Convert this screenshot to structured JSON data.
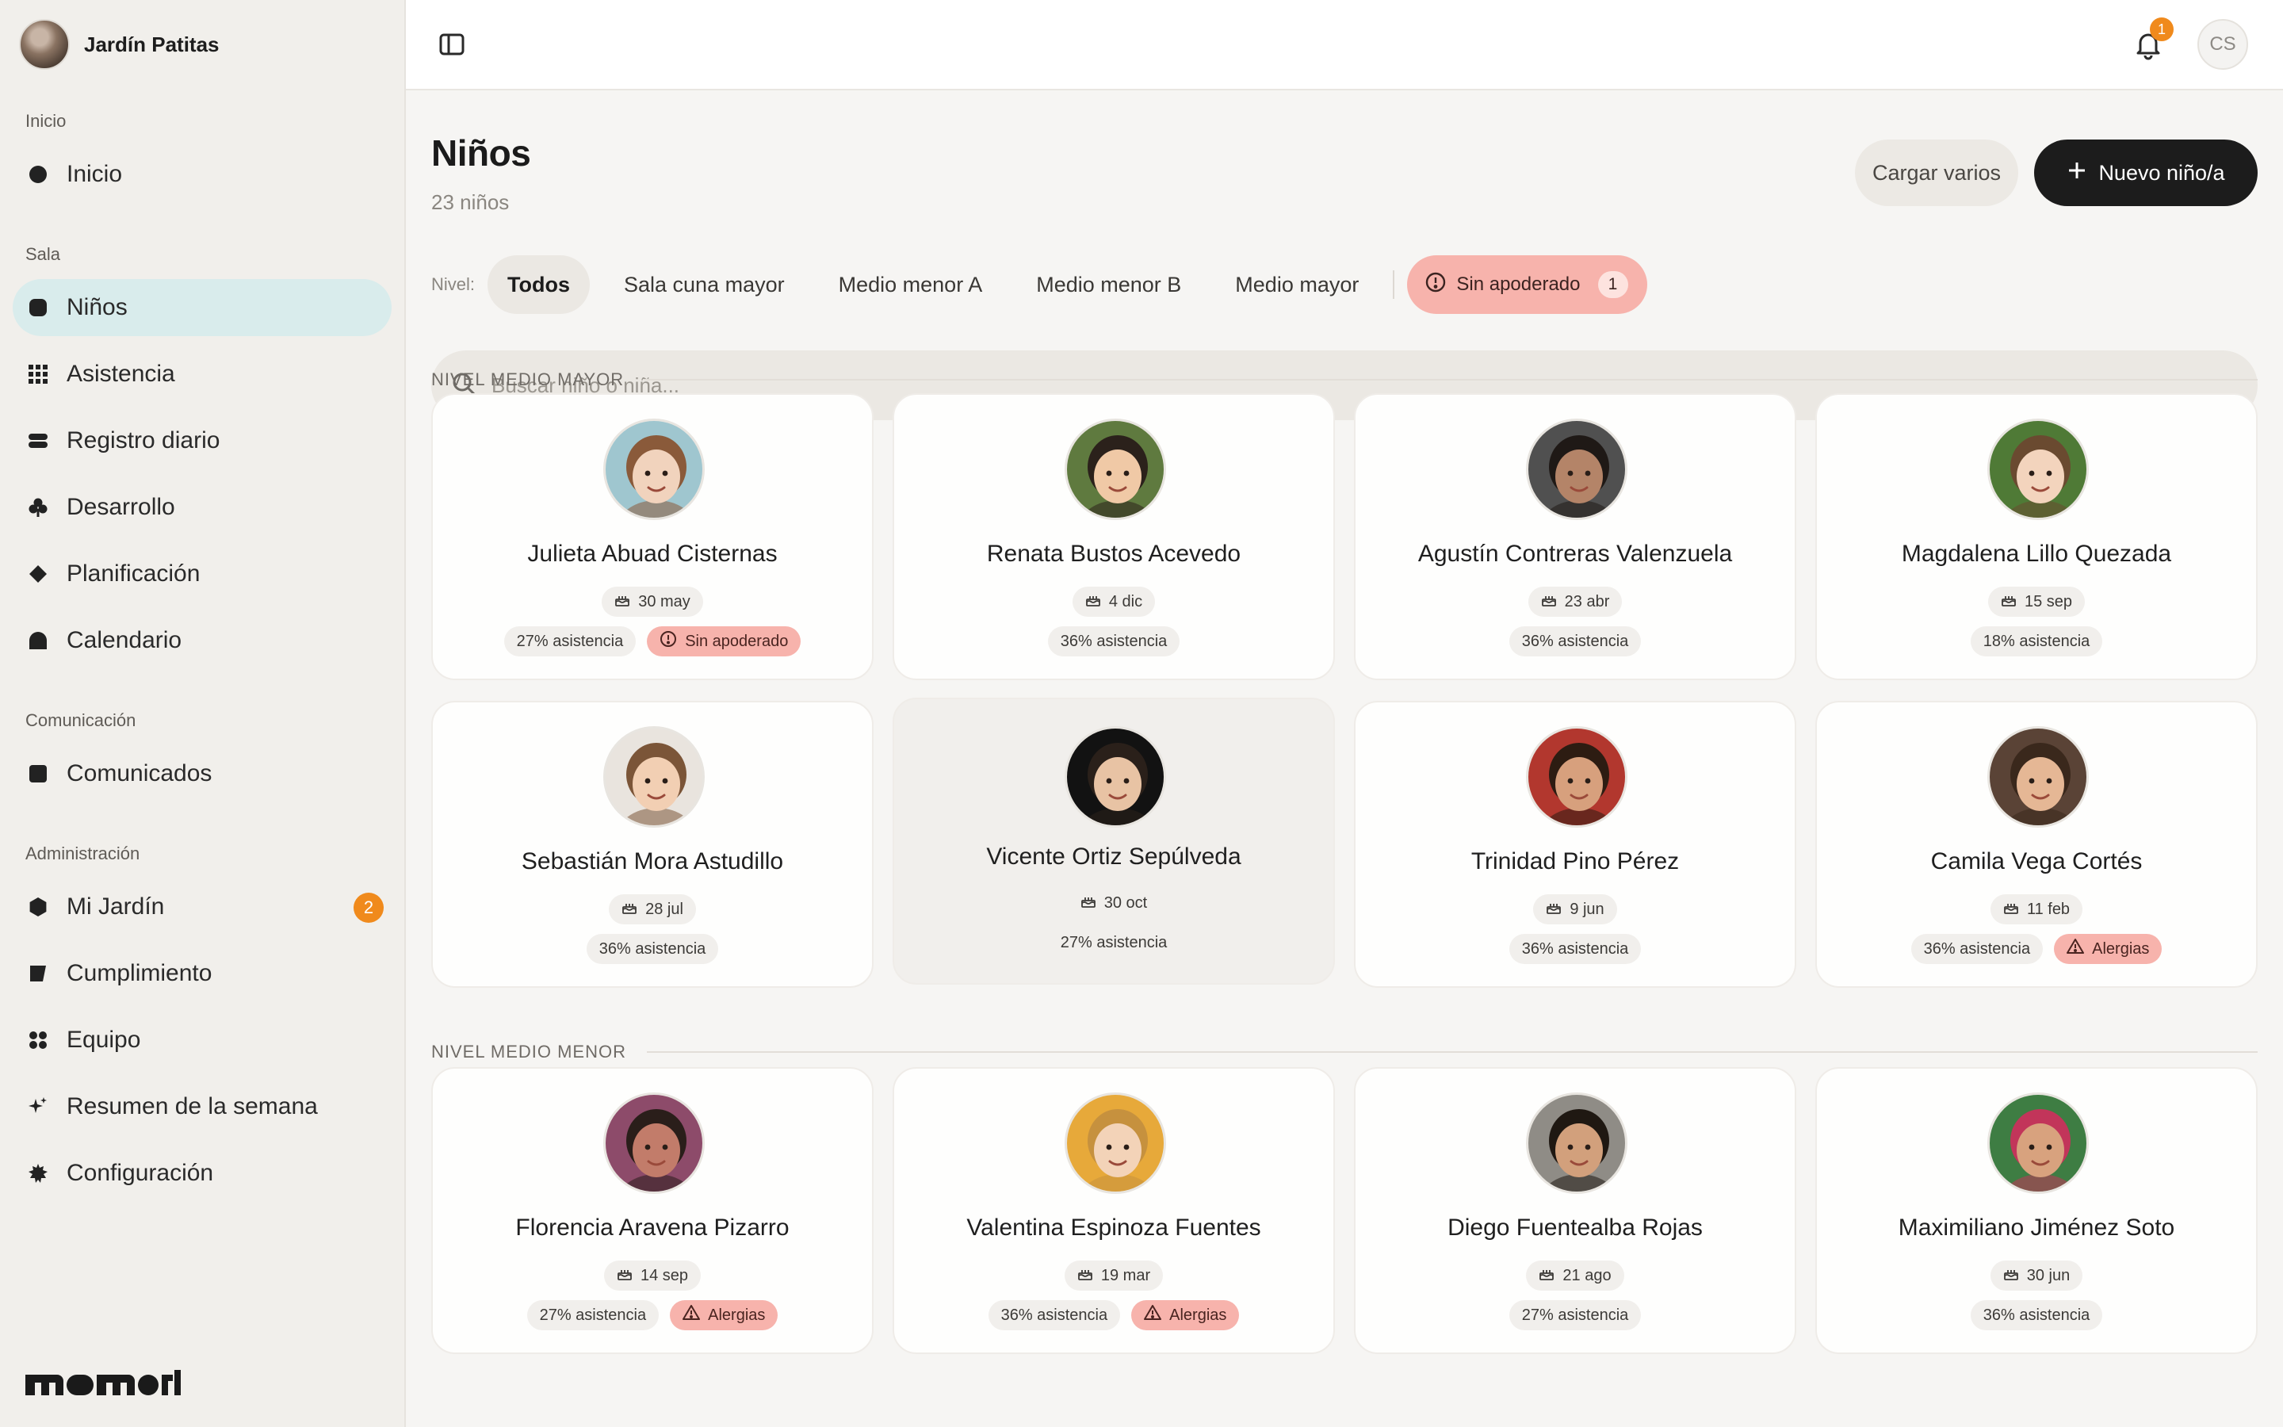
{
  "sidebar": {
    "brand_name": "Jardín Patitas",
    "sections": {
      "inicio": "Inicio",
      "sala": "Sala",
      "comunicacion": "Comunicación",
      "administracion": "Administración"
    },
    "items": [
      {
        "label": "Inicio",
        "icon": "circle-icon"
      },
      {
        "label": "Niños",
        "icon": "rounded-square-icon",
        "active": true
      },
      {
        "label": "Asistencia",
        "icon": "grid-icon"
      },
      {
        "label": "Registro diario",
        "icon": "stack-icon"
      },
      {
        "label": "Desarrollo",
        "icon": "club-icon"
      },
      {
        "label": "Planificación",
        "icon": "diamond-icon"
      },
      {
        "label": "Calendario",
        "icon": "dome-icon"
      },
      {
        "label": "Comunicados",
        "icon": "square-icon"
      },
      {
        "label": "Mi Jardín",
        "icon": "hexagon-icon",
        "badge": "2"
      },
      {
        "label": "Cumplimiento",
        "icon": "flag-icon"
      },
      {
        "label": "Equipo",
        "icon": "dots-icon"
      },
      {
        "label": "Resumen de la semana",
        "icon": "sparkle-icon"
      },
      {
        "label": "Configuración",
        "icon": "gear-icon"
      }
    ],
    "logo_text": "momori"
  },
  "topbar": {
    "notification_count": "1",
    "user_initials": "CS"
  },
  "page": {
    "title": "Niños",
    "subtitle": "23 niños",
    "btn_bulk": "Cargar varios",
    "btn_new": "Nuevo niño/a",
    "filter_label": "Nivel:",
    "filters": [
      "Todos",
      "Sala cuna mayor",
      "Medio menor A",
      "Medio menor B",
      "Medio mayor"
    ],
    "alert_filter": {
      "label": "Sin apoderado",
      "count": "1"
    },
    "search_placeholder": "Buscar niño o niña..."
  },
  "groups": [
    {
      "title": "NIVEL MEDIO MAYOR",
      "children": [
        {
          "name": "Julieta Abuad Cisternas",
          "birthday": "30 may",
          "attendance": "27% asistencia",
          "flag": "Sin apoderado",
          "flag_icon": "alert-circle-icon",
          "skin": "#f1d3bd",
          "hair": "#8a5a3a",
          "bg": "#9fc6cf"
        },
        {
          "name": "Renata Bustos Acevedo",
          "birthday": "4 dic",
          "attendance": "36% asistencia",
          "flag": "",
          "skin": "#f0c9a6",
          "hair": "#2b211b",
          "bg": "#5f7a3f"
        },
        {
          "name": "Agustín Contreras Valenzuela",
          "birthday": "23 abr",
          "attendance": "36% asistencia",
          "flag": "",
          "skin": "#b48468",
          "hair": "#1f1916",
          "bg": "#505050"
        },
        {
          "name": "Magdalena Lillo Quezada",
          "birthday": "15 sep",
          "attendance": "18% asistencia",
          "flag": "",
          "skin": "#f3d4bd",
          "hair": "#6a4a30",
          "bg": "#4f7a36"
        }
      ]
    },
    {
      "title": "",
      "children": [
        {
          "name": "Sebastián Mora Astudillo",
          "birthday": "28 jul",
          "attendance": "36% asistencia",
          "flag": "",
          "skin": "#f2cfb3",
          "hair": "#7b5538",
          "bg": "#e9e4de"
        },
        {
          "name": "Vicente Ortiz Sepúlveda",
          "birthday": "30 oct",
          "attendance": "27% asistencia",
          "flag": "",
          "skin": "#e8c3a4",
          "hair": "#2a201a",
          "bg": "#121212",
          "hover": true
        },
        {
          "name": "Trinidad Pino Pérez",
          "birthday": "9 jun",
          "attendance": "36% asistencia",
          "flag": "",
          "skin": "#d7a07d",
          "hair": "#2d1c12",
          "bg": "#b2372e"
        },
        {
          "name": "Camila Vega Cortés",
          "birthday": "11 feb",
          "attendance": "36% asistencia",
          "flag": "Alergias",
          "flag_icon": "warning-triangle-icon",
          "skin": "#e5b795",
          "hair": "#3a281c",
          "bg": "#5a4336"
        }
      ]
    },
    {
      "title": "NIVEL MEDIO MENOR",
      "children": [
        {
          "name": "Florencia Aravena Pizarro",
          "birthday": "14 sep",
          "attendance": "27% asistencia",
          "flag": "Alergias",
          "flag_icon": "warning-triangle-icon",
          "skin": "#c27c6a",
          "hair": "#2a1e1a",
          "bg": "#8d4b6a"
        },
        {
          "name": "Valentina Espinoza Fuentes",
          "birthday": "19 mar",
          "attendance": "36% asistencia",
          "flag": "Alergias",
          "flag_icon": "warning-triangle-icon",
          "skin": "#f3d3b8",
          "hair": "#c6913e",
          "bg": "#e7a93a"
        },
        {
          "name": "Diego Fuentealba Rojas",
          "birthday": "21 ago",
          "attendance": "27% asistencia",
          "flag": "",
          "skin": "#d2a07c",
          "hair": "#1f1812",
          "bg": "#8f8c86"
        },
        {
          "name": "Maximiliano Jiménez Soto",
          "birthday": "30 jun",
          "attendance": "36% asistencia",
          "flag": "",
          "skin": "#d8a27e",
          "hair": "#c2355a",
          "bg": "#3e7d43"
        }
      ]
    }
  ],
  "colors": {
    "accent": "#1c1c1c",
    "active_nav": "#d9ecec",
    "alert": "#f7b3ac",
    "badge": "#f08a1c"
  }
}
